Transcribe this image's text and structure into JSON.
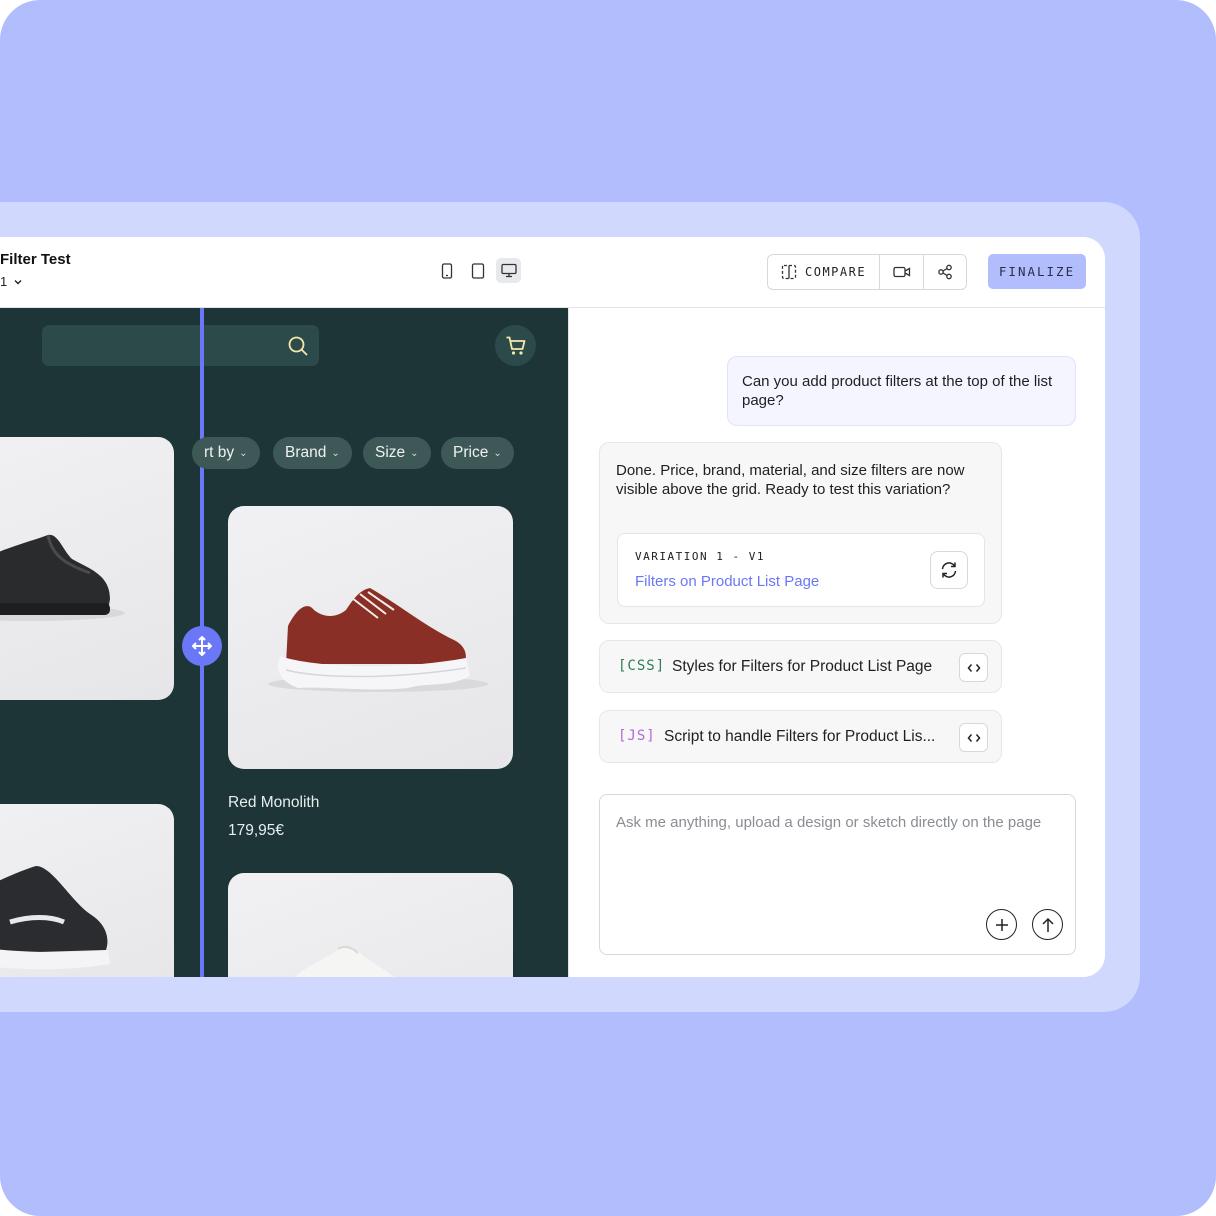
{
  "header": {
    "title": "Filter Test",
    "variant": "1",
    "compare_label": "COMPARE",
    "finalize_label": "FINALIZE",
    "device_icons": [
      "mobile-icon",
      "tablet-icon",
      "desktop-icon"
    ]
  },
  "preview": {
    "filters": [
      {
        "label": "rt by"
      },
      {
        "label": "Brand"
      },
      {
        "label": "Size"
      },
      {
        "label": "Price"
      }
    ],
    "product": {
      "name": "Red Monolith",
      "price": "179,95€"
    }
  },
  "chat": {
    "user_message": "Can you add product filters at the top of the list page?",
    "ai_message": "Done. Price, brand, material, and size filters are now visible above the grid. Ready to test this variation?",
    "variation_label": "VARIATION 1 - V1",
    "variation_link": "Filters on Product List Page",
    "code_items": [
      {
        "tag": "[CSS]",
        "title": "Styles for Filters for Product List Page",
        "color": "#2f7d56"
      },
      {
        "tag": "[JS]",
        "title": "Script to handle Filters for Product Lis...",
        "color": "#b06ad8"
      }
    ],
    "composer_placeholder": "Ask me anything, upload a design or sketch directly on the page"
  },
  "colors": {
    "background": "#b1bdfd",
    "accent": "#6a78f7",
    "preview_bg": "#1d3537"
  }
}
